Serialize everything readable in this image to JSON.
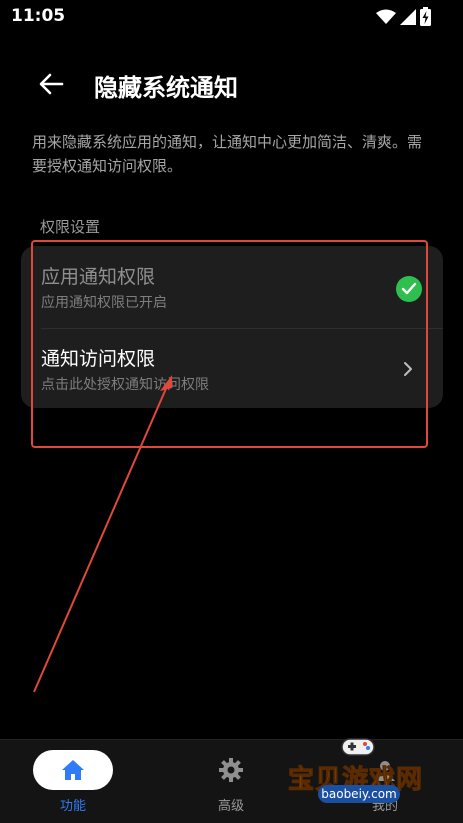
{
  "status_bar": {
    "time": "11:05"
  },
  "app_bar": {
    "title": "隐藏系统通知"
  },
  "description": "用来隐藏系统应用的通知，让通知中心更加简洁、清爽。需要授权通知访问权限。",
  "section": {
    "label": "权限设置",
    "items": [
      {
        "title": "应用通知权限",
        "subtitle": "应用通知权限已开启",
        "status": "granted",
        "status_color": "#2fbf4f"
      },
      {
        "title": "通知访问权限",
        "subtitle": "点击此处授权通知访问权限",
        "status": "action"
      }
    ]
  },
  "annotation": {
    "color": "#e0483c"
  },
  "bottom_nav": {
    "items": [
      {
        "label": "功能",
        "icon": "home-icon",
        "active": true
      },
      {
        "label": "高级",
        "icon": "gear-icon",
        "active": false
      },
      {
        "label": "我的",
        "icon": "user-icon",
        "active": false
      }
    ],
    "active_color": "#2f7cf6"
  },
  "watermark": {
    "text": "宝贝游戏网",
    "url": "baobeiy.com"
  }
}
